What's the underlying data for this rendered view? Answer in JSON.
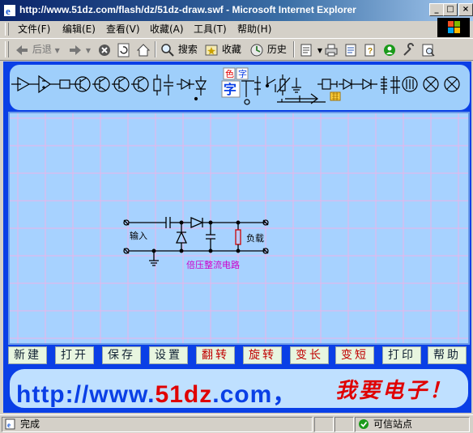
{
  "window": {
    "title": "http://www.51dz.com/flash/dz/51dz-draw.swf - Microsoft Internet Explorer"
  },
  "menu": [
    "文件(F)",
    "编辑(E)",
    "查看(V)",
    "收藏(A)",
    "工具(T)",
    "帮助(H)"
  ],
  "toolbar": {
    "back_label": "后退",
    "search_label": "搜索",
    "favorites_label": "收藏",
    "history_label": "历史"
  },
  "palette": {
    "color_label": "色",
    "char_label_small": "字",
    "char_label_big": "字"
  },
  "circuit": {
    "input_label": "输入",
    "load_label": "负载",
    "caption": "倍压整流电路",
    "caption_color": "#cc00cc"
  },
  "buttons": [
    {
      "label": "新建",
      "style": "dark"
    },
    {
      "label": "打开",
      "style": "dark"
    },
    {
      "label": "保存",
      "style": "dark"
    },
    {
      "label": "设置",
      "style": "dark"
    },
    {
      "label": "翻转",
      "style": "red"
    },
    {
      "label": "旋转",
      "style": "red"
    },
    {
      "label": "变长",
      "style": "red"
    },
    {
      "label": "变短",
      "style": "red"
    },
    {
      "label": "打印",
      "style": "dark"
    },
    {
      "label": "帮助",
      "style": "dark"
    }
  ],
  "banner": {
    "url_prefix": "http://www.",
    "url_highlight": "51dz",
    "url_suffix": ".com，",
    "slogan": "我要电子！",
    "highlight_color": "#e00000"
  },
  "status": {
    "text": "完成",
    "zone": "可信站点"
  },
  "colors": {
    "flash_bg": "#0a3fe6",
    "grid_line": "#e8b4e8",
    "canvas_bg": "#a7d2ff"
  }
}
